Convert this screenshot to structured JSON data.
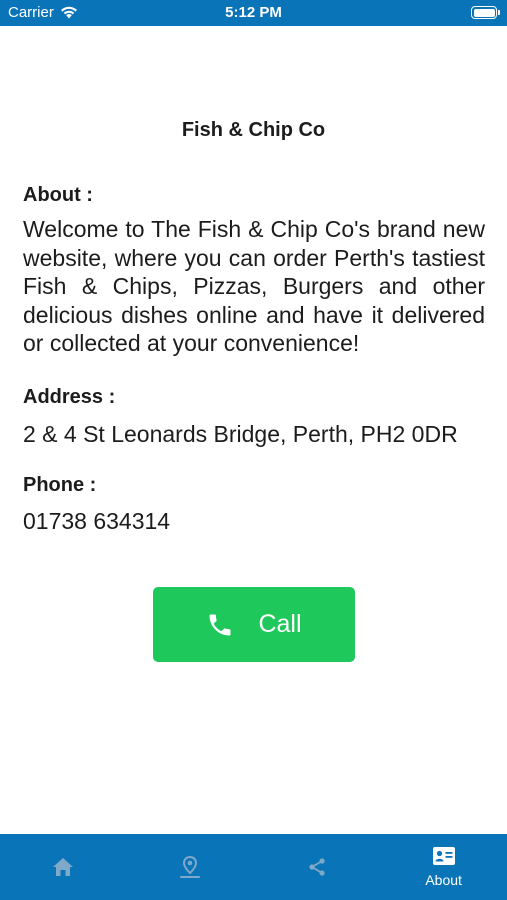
{
  "status_bar": {
    "carrier": "Carrier",
    "time": "5:12 PM"
  },
  "shop": {
    "name": "Fish & Chip Co"
  },
  "about": {
    "heading": "About :",
    "text": "Welcome to The Fish & Chip Co's brand new website, where you can order Perth's tastiest Fish & Chips, Pizzas, Burgers and other delicious dishes online and have it delivered or collected at your convenience!"
  },
  "address": {
    "heading": "Address :",
    "value": "2 & 4 St Leonards Bridge, Perth, PH2 0DR"
  },
  "phone": {
    "heading": "Phone :",
    "value": "01738 634314"
  },
  "call_button": {
    "label": "Call",
    "icon": "phone-icon"
  },
  "tab_bar": {
    "items": [
      {
        "icon": "home-icon",
        "label": ""
      },
      {
        "icon": "map-pin-icon",
        "label": ""
      },
      {
        "icon": "share-icon",
        "label": ""
      },
      {
        "icon": "contact-card-icon",
        "label": "About"
      }
    ]
  },
  "colors": {
    "brand": "#0a74b8",
    "call_button": "#1fc85a",
    "tab_inactive": "#7fa9c9",
    "tab_active": "#ffffff"
  }
}
